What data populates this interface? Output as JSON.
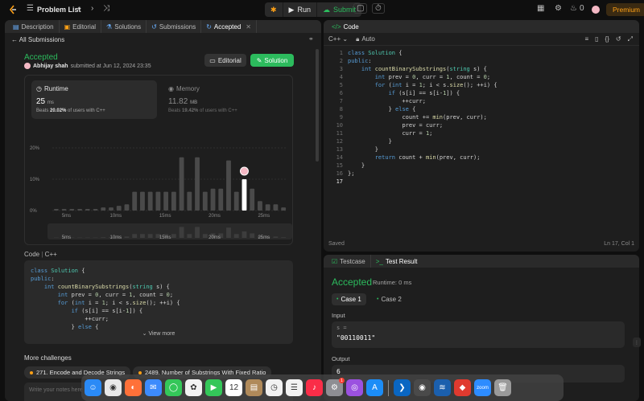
{
  "nav": {
    "problem_list": "Problem List",
    "run": "Run",
    "submit": "Submit",
    "streak": "0",
    "premium": "Premium"
  },
  "left_tabs": [
    {
      "label": "Description",
      "icon": "description-icon"
    },
    {
      "label": "Editorial",
      "icon": "editorial-icon"
    },
    {
      "label": "Solutions",
      "icon": "solutions-icon"
    },
    {
      "label": "Submissions",
      "icon": "submissions-icon"
    },
    {
      "label": "Accepted",
      "icon": "accepted-icon"
    }
  ],
  "submission": {
    "back_label": "All Submissions",
    "status": "Accepted",
    "user": "Abhijay shah",
    "submitted_text": "submitted at Jun 12, 2024 23:35",
    "editorial_btn": "Editorial",
    "solution_btn": "Solution"
  },
  "runtime": {
    "title": "Runtime",
    "value": "25",
    "unit": "ms",
    "beats_prefix": "Beats",
    "beats_pct": "20.02%",
    "beats_suffix": "of users with C++"
  },
  "memory": {
    "title": "Memory",
    "value": "11.82",
    "unit": "MB",
    "beats_prefix": "Beats",
    "beats_pct": "19.42%",
    "beats_suffix": "of users with C++"
  },
  "chart_data": {
    "type": "bar",
    "y_ticks": [
      "20%",
      "10%",
      "0%"
    ],
    "ylim": [
      0,
      20
    ],
    "x_ticks": [
      "5ms",
      "10ms",
      "15ms",
      "20ms",
      "25ms"
    ],
    "values": [
      0.5,
      0.5,
      0.5,
      0.5,
      0.5,
      0.5,
      1,
      1,
      1.5,
      2,
      6,
      6,
      6,
      6,
      6,
      6,
      17,
      6,
      17,
      6,
      7,
      7,
      16,
      6,
      10,
      7,
      3,
      2,
      2,
      1
    ],
    "highlight_index": 24
  },
  "code_section": {
    "label": "Code",
    "lang": "C++",
    "lines": [
      "class Solution {",
      "public:",
      "    int countBinarySubstrings(string s) {",
      "        int prev = 0, curr = 1, count = 0;",
      "        for (int i = 1; i < s.size(); ++i) {",
      "            if (s[i] == s[i-1]) {",
      "                ++curr;",
      "            } else {"
    ],
    "view_more": "View more"
  },
  "more_challenges": {
    "title": "More challenges",
    "items": [
      "271. Encode and Decode Strings",
      "2489. Number of Substrings With Fixed Ratio"
    ]
  },
  "notes_placeholder": "Write your notes here",
  "editor": {
    "tab": "Code",
    "language": "C++",
    "mode": "Auto",
    "status": "Saved",
    "cursor": "Ln 17, Col 1",
    "current_line": 17,
    "lines": [
      "class Solution {",
      "public:",
      "    int countBinarySubstrings(string s) {",
      "        int prev = 0, curr = 1, count = 0;",
      "        for (int i = 1; i < s.size(); ++i) {",
      "            if (s[i] == s[i-1]) {",
      "                ++curr;",
      "            } else {",
      "                count += min(prev, curr);",
      "                prev = curr;",
      "                curr = 1;",
      "            }",
      "        }",
      "        return count + min(prev, curr);",
      "    }",
      "};",
      ""
    ]
  },
  "test": {
    "tab_testcase": "Testcase",
    "tab_result": "Test Result",
    "status": "Accepted",
    "runtime": "Runtime: 0 ms",
    "cases": [
      "Case 1",
      "Case 2"
    ],
    "input_label": "Input",
    "input_var": "s =",
    "input_val": "\"00110011\"",
    "output_label": "Output",
    "output_val": "6"
  },
  "dock": {
    "apps": [
      {
        "name": "finder-icon",
        "color": "#2a8af6",
        "glyph": "☺"
      },
      {
        "name": "chrome-icon",
        "color": "#e8e8e8",
        "glyph": "◉"
      },
      {
        "name": "firefox-icon",
        "color": "#ff7139",
        "glyph": "◐"
      },
      {
        "name": "mail-icon",
        "color": "#3d8bfd",
        "glyph": "✉"
      },
      {
        "name": "messages-icon",
        "color": "#34c759",
        "glyph": "◯"
      },
      {
        "name": "photos-icon",
        "color": "#f2f2f2",
        "glyph": "✿"
      },
      {
        "name": "facetime-icon",
        "color": "#34c759",
        "glyph": "▶"
      },
      {
        "name": "calendar-icon",
        "color": "#ffffff",
        "glyph": "12"
      },
      {
        "name": "notes-icon",
        "color": "#b08a5a",
        "glyph": "▤"
      },
      {
        "name": "clock-icon",
        "color": "#f2f2f2",
        "glyph": "◷"
      },
      {
        "name": "reminders-icon",
        "color": "#f2f2f2",
        "glyph": "☰"
      },
      {
        "name": "music-icon",
        "color": "#fa2d48",
        "glyph": "♪"
      },
      {
        "name": "settings-icon",
        "color": "#8e8e93",
        "glyph": "⚙"
      },
      {
        "name": "podcasts-icon",
        "color": "#9b51e0",
        "glyph": "◎"
      },
      {
        "name": "app-store-icon",
        "color": "#1c8df7",
        "glyph": "A"
      },
      {
        "name": "vscode-icon",
        "color": "#0a66c2",
        "glyph": "❯"
      },
      {
        "name": "quicktime-icon",
        "color": "#4a4a4a",
        "glyph": "◉"
      },
      {
        "name": "wireshark-icon",
        "color": "#1b5fad",
        "glyph": "≋"
      },
      {
        "name": "anydesk-icon",
        "color": "#e03a2f",
        "glyph": "◆"
      },
      {
        "name": "zoom-icon",
        "color": "#2d8cff",
        "glyph": "zoom"
      },
      {
        "name": "trash-icon",
        "color": "#9a9a9a",
        "glyph": "🗑"
      }
    ],
    "settings_badge": "1"
  }
}
